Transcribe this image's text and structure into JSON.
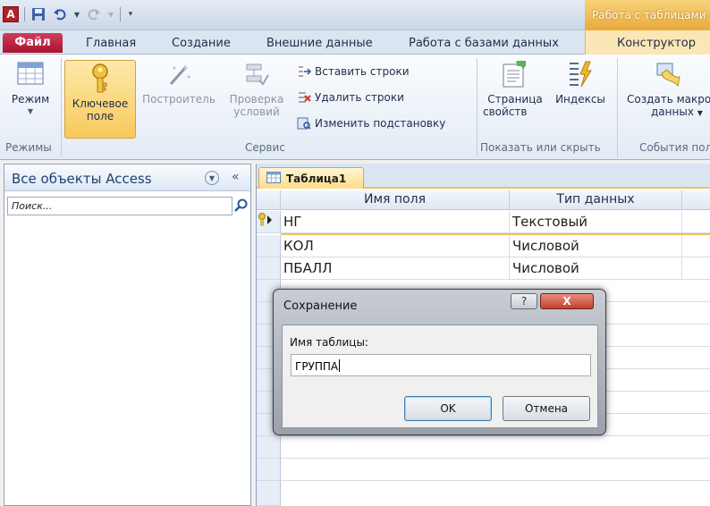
{
  "app": {
    "icon_letter": "A",
    "contextual_title": "Работа с таблицами"
  },
  "tabs": {
    "file": "Файл",
    "home": "Главная",
    "create": "Создание",
    "external": "Внешние данные",
    "dbtools": "Работа с базами данных",
    "design": "Конструктор"
  },
  "ribbon": {
    "views_group": "Режимы",
    "view_btn": "Режим",
    "key_btn_line1": "Ключевое",
    "key_btn_line2": "поле",
    "builder_btn": "Построитель",
    "check_btn_line1": "Проверка",
    "check_btn_line2": "условий",
    "insert_rows": "Вставить строки",
    "delete_rows": "Удалить строки",
    "modify_lookup": "Изменить подстановку",
    "tools_group": "Сервис",
    "props_line1": "Страница",
    "props_line2": "свойств",
    "indexes_btn": "Индексы",
    "showhide_group": "Показать или скрыть",
    "macros_line1": "Создать макросы",
    "macros_line2": "данных",
    "events_group": "События полей"
  },
  "nav": {
    "title": "Все объекты Access",
    "search_placeholder": "Поиск..."
  },
  "table": {
    "tab_label": "Таблица1",
    "col_field": "Имя поля",
    "col_type": "Тип данных",
    "rows": [
      {
        "name": "НГ",
        "type": "Текстовый"
      },
      {
        "name": "КОЛ",
        "type": "Числовой"
      },
      {
        "name": "ПБАЛЛ",
        "type": "Числовой"
      }
    ]
  },
  "dialog": {
    "title": "Сохранение",
    "help": "?",
    "close": "X",
    "label": "Имя таблицы:",
    "value": "ГРУППА",
    "ok": "OK",
    "cancel": "Отмена"
  },
  "colors": {
    "file_tab": "#b31a36",
    "contextual": "#f1b23f",
    "accent_blue": "#1f3f78"
  }
}
